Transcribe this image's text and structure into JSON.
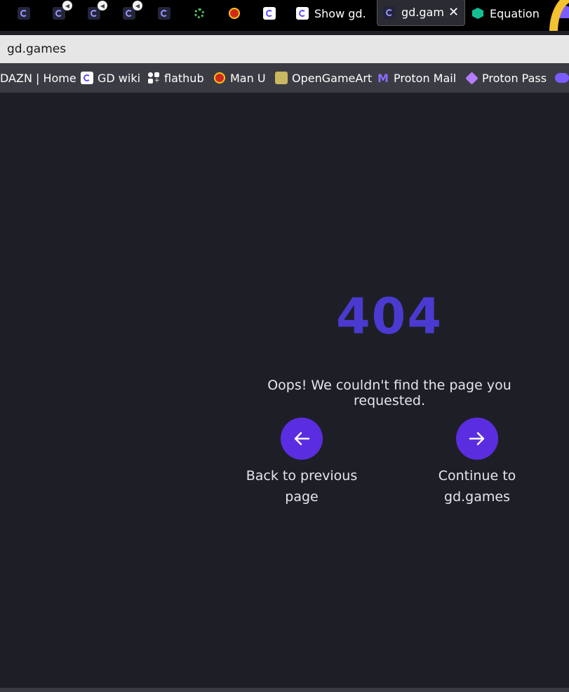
{
  "tabs": [
    {
      "icon": "gd-icon",
      "title": "",
      "audio": false
    },
    {
      "icon": "gd-icon",
      "title": "",
      "audio": true
    },
    {
      "icon": "gd-icon",
      "title": "",
      "audio": true
    },
    {
      "icon": "gd-icon",
      "title": "",
      "audio": true
    },
    {
      "icon": "gd-icon",
      "title": "",
      "audio": false
    },
    {
      "icon": "ring-icon",
      "title": "",
      "audio": false
    },
    {
      "icon": "manu-crest-icon",
      "title": "",
      "audio": false
    },
    {
      "icon": "gd-icon",
      "title": "",
      "audio": false
    },
    {
      "icon": "gd-icon",
      "title": "Show gd.g",
      "audio": false
    },
    {
      "icon": "gd-icon",
      "title": "gd.gam",
      "audio": false,
      "active": true
    },
    {
      "icon": "khan-icon",
      "title": "Equation",
      "audio": false
    }
  ],
  "address_bar": {
    "value": "gd.games"
  },
  "bookmarks": [
    {
      "label": "DAZN | Home",
      "icon": "none"
    },
    {
      "label": "GD wiki",
      "icon": "gd-icon"
    },
    {
      "label": "flathub",
      "icon": "flathub-icon"
    },
    {
      "label": "Man U",
      "icon": "manu-crest-icon"
    },
    {
      "label": "OpenGameArt",
      "icon": "opengameart-icon"
    },
    {
      "label": "Proton Mail",
      "icon": "proton-mail-icon"
    },
    {
      "label": "Proton Pass",
      "icon": "proton-pass-icon"
    }
  ],
  "page": {
    "error_code": "404",
    "message": "Oops! We couldn't find the page you requested.",
    "back_label_1": "Back to previous",
    "back_label_2": "page",
    "continue_label_1": "Continue to",
    "continue_label_2": "gd.games"
  },
  "colors": {
    "background": "#1e1f26",
    "accent_text": "#4a3ad0",
    "button": "#5b2de0"
  }
}
